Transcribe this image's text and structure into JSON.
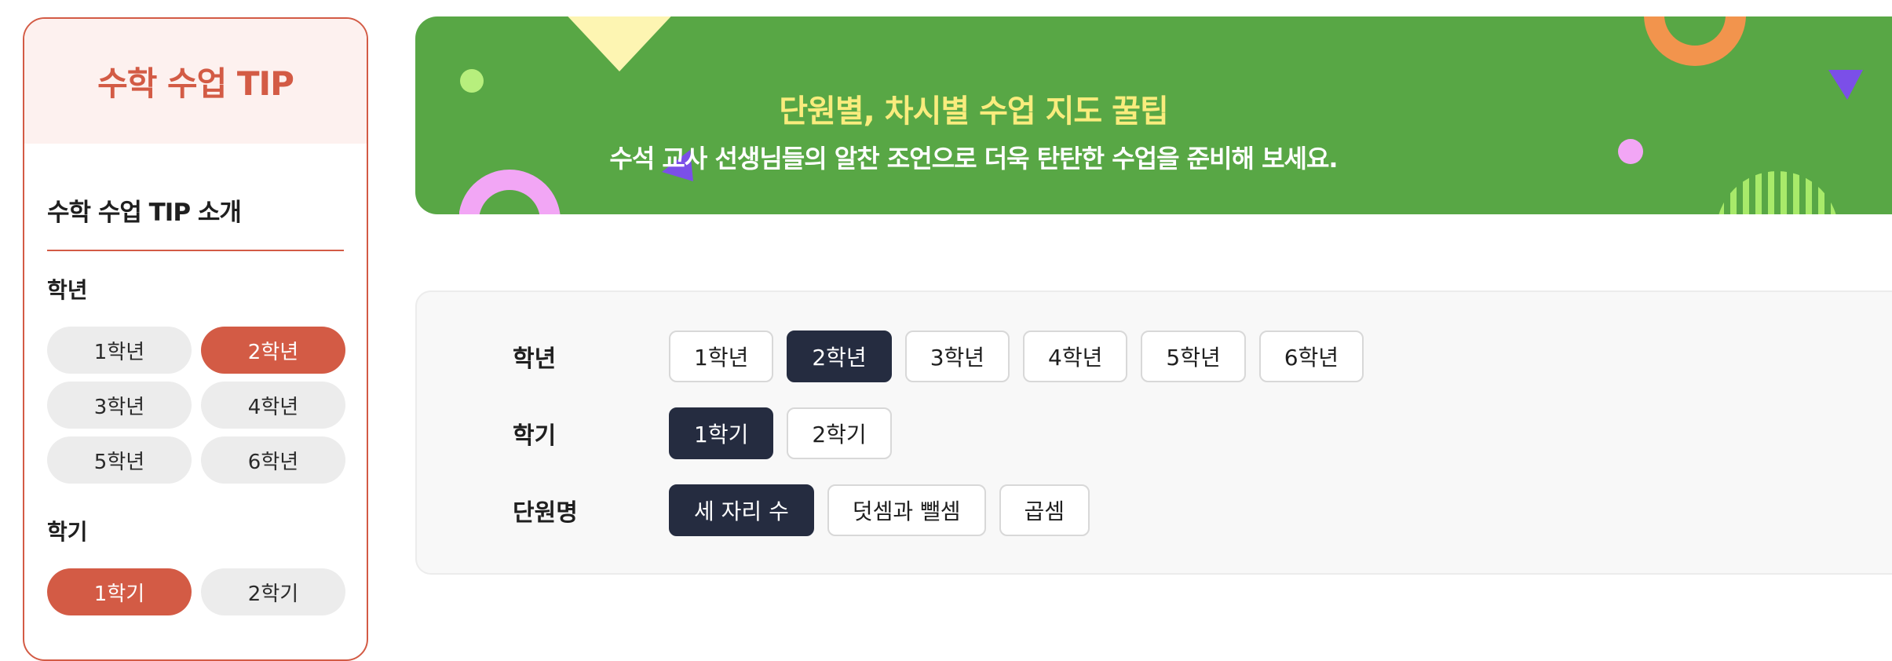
{
  "sidebar": {
    "title": "수학 수업 TIP",
    "intro_link": "수학 수업 TIP 소개",
    "grade_label": "학년",
    "grades": [
      "1학년",
      "2학년",
      "3학년",
      "4학년",
      "5학년",
      "6학년"
    ],
    "selected_grade": "2학년",
    "semester_label": "학기",
    "semesters": [
      "1학기",
      "2학기"
    ],
    "selected_semester": "1학기"
  },
  "banner": {
    "title": "단원별, 차시별 수업 지도 꿀팁",
    "subtitle": "수석 교사 선생님들의 알찬 조언으로 더욱 탄탄한 수업을 준비해 보세요."
  },
  "filters": {
    "grade_label": "학년",
    "grades": [
      "1학년",
      "2학년",
      "3학년",
      "4학년",
      "5학년",
      "6학년"
    ],
    "selected_grade": "2학년",
    "semester_label": "학기",
    "semesters": [
      "1학기",
      "2학기"
    ],
    "selected_semester": "1학기",
    "unit_label": "단원명",
    "units": [
      "세 자리 수",
      "덧셈과 뺄셈",
      "곱셈"
    ],
    "selected_unit": "세 자리 수"
  },
  "colors": {
    "accent": "#d35b45",
    "banner_green": "#58a745",
    "banner_title": "#f9ec7d",
    "chip_active": "#252c40"
  }
}
